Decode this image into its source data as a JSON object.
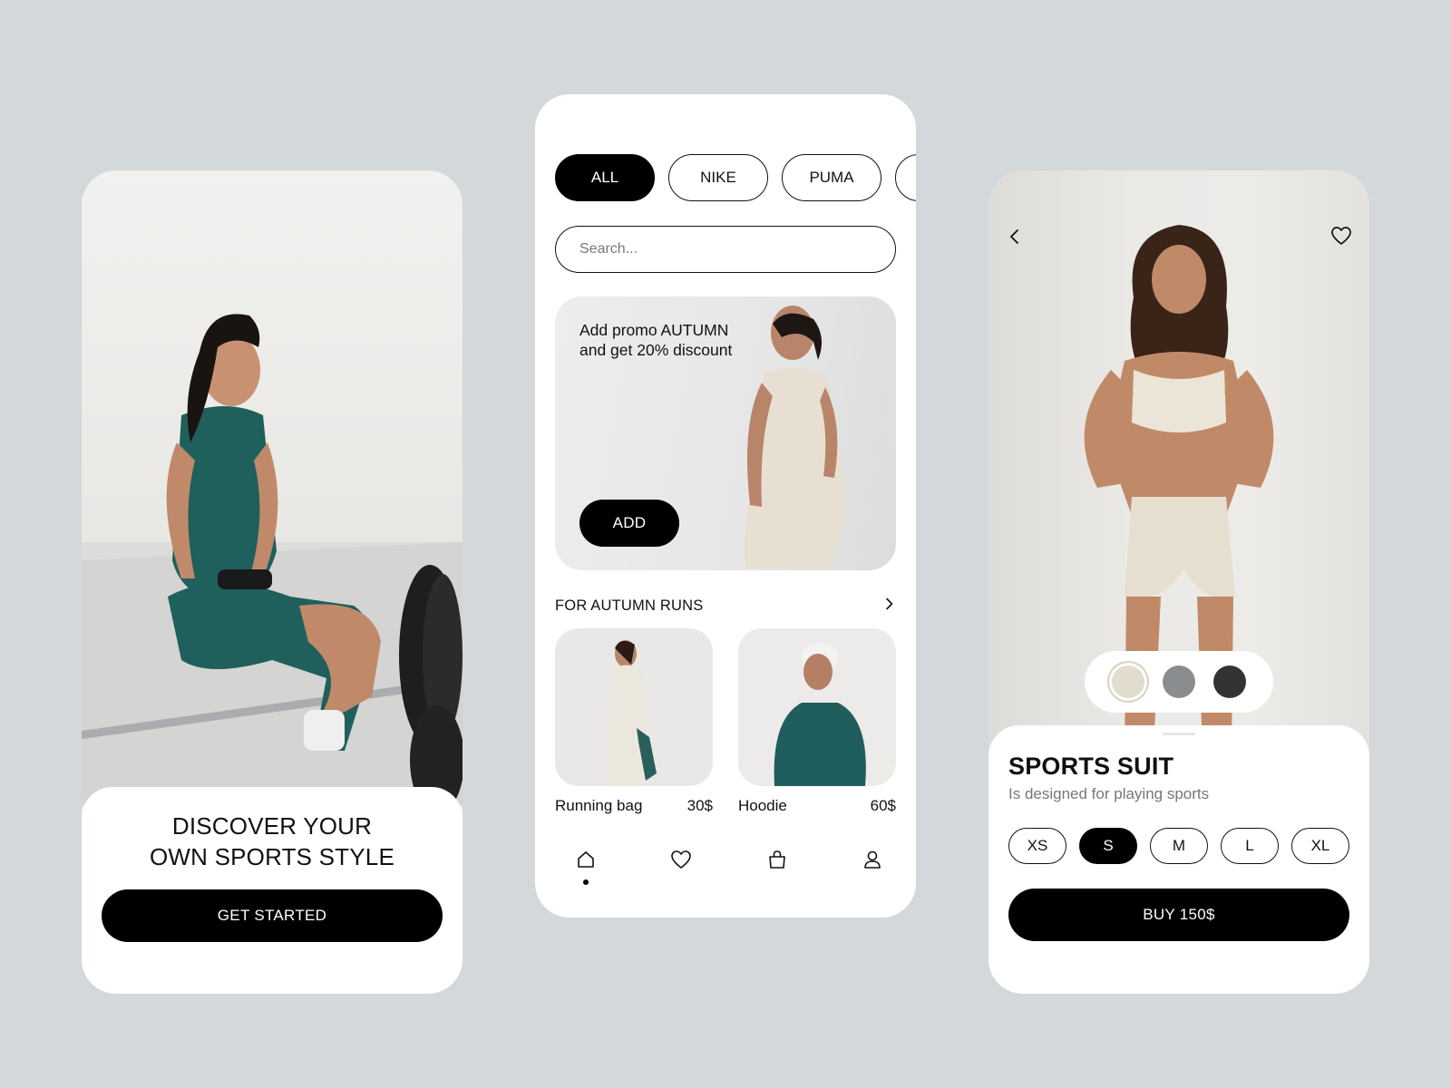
{
  "onboarding": {
    "title": "DISCOVER YOUR\nOWN SPORTS STYLE",
    "cta_label": "GET STARTED"
  },
  "shop": {
    "brands": [
      {
        "label": "ALL",
        "active": true
      },
      {
        "label": "NIKE",
        "active": false
      },
      {
        "label": "PUMA",
        "active": false
      },
      {
        "label": "",
        "active": false
      }
    ],
    "search": {
      "placeholder": "Search...",
      "value": ""
    },
    "promo": {
      "text": "Add promo AUTUMN\nand get 20% discount",
      "button_label": "ADD"
    },
    "section": {
      "title": "FOR AUTUMN RUNS",
      "more_icon": "chevron-right-icon"
    },
    "products": [
      {
        "name": "Running bag",
        "price": "30$"
      },
      {
        "name": "Hoodie",
        "price": "60$"
      }
    ],
    "tabbar": [
      "home-icon",
      "heart-icon",
      "bag-icon",
      "profile-icon"
    ],
    "active_tab": "home-icon"
  },
  "product": {
    "title": "SPORTS SUIT",
    "subtitle": "Is designed for playing sports",
    "colors": [
      "#e2dccf",
      "#8a8d90",
      "#333333"
    ],
    "selected_color": "#e2dccf",
    "sizes": [
      "XS",
      "S",
      "M",
      "L",
      "XL"
    ],
    "selected_size": "S",
    "buy_label": "BUY 150$",
    "back_icon": "chevron-left-icon",
    "favorite_icon": "heart-icon"
  }
}
